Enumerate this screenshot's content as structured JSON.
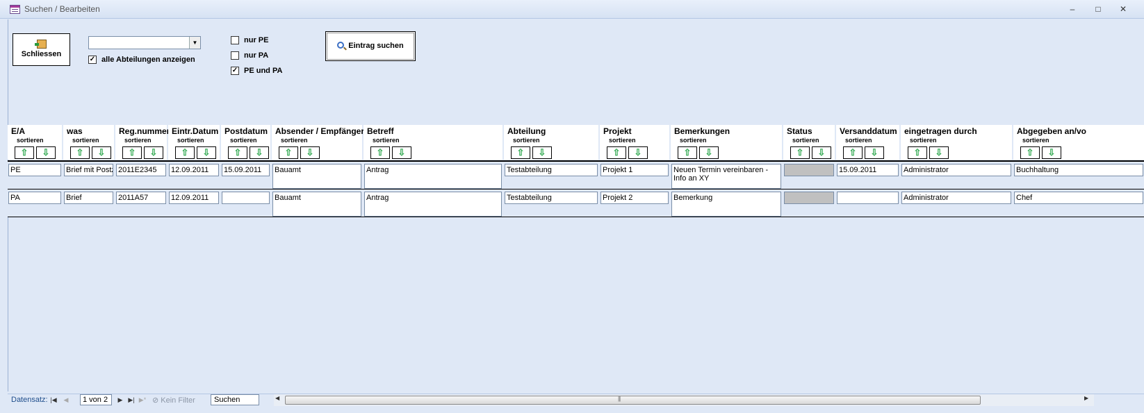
{
  "window": {
    "title": "Suchen / Bearbeiten",
    "min": "–",
    "max": "□",
    "close": "✕"
  },
  "toolbar": {
    "close_label": "Schliessen",
    "search_label": "Eintrag suchen",
    "dept_combo_value": "",
    "show_all_depts": {
      "label": "alle Abteilungen anzeigen",
      "checked": true
    },
    "nur_pe": {
      "label": "nur PE",
      "checked": false
    },
    "nur_pa": {
      "label": "nur PA",
      "checked": false
    },
    "pe_und_pa": {
      "label": "PE und PA",
      "checked": true
    }
  },
  "grid": {
    "sort_label": "sortieren",
    "columns": [
      "E/A",
      "was",
      "Reg.nummer",
      "Eintr.Datum",
      "Postdatum",
      "Absender / Empfänger",
      "Betreff",
      "Abteilung",
      "Projekt",
      "Bemerkungen",
      "Status",
      "Versanddatum",
      "eingetragen durch",
      "Abgegeben an/vo"
    ],
    "rows": [
      [
        "PE",
        "Brief mit Postzu",
        "2011E2345",
        "12.09.2011",
        "15.09.2011",
        "Bauamt",
        "Antrag",
        "Testabteilung",
        "Projekt 1",
        "Neuen Termin vereinbaren - Info an XY",
        "",
        "15.09.2011",
        "Administrator",
        "Buchhaltung"
      ],
      [
        "PA",
        "Brief",
        "2011A57",
        "12.09.2011",
        "",
        "Bauamt",
        "Antrag",
        "Testabteilung",
        "Projekt 2",
        "Bemerkung",
        "",
        "",
        "Administrator",
        "Chef"
      ]
    ]
  },
  "navbar": {
    "label": "Datensatz:",
    "record": "1 von 2",
    "filter": "Kein Filter",
    "search": "Suchen"
  }
}
